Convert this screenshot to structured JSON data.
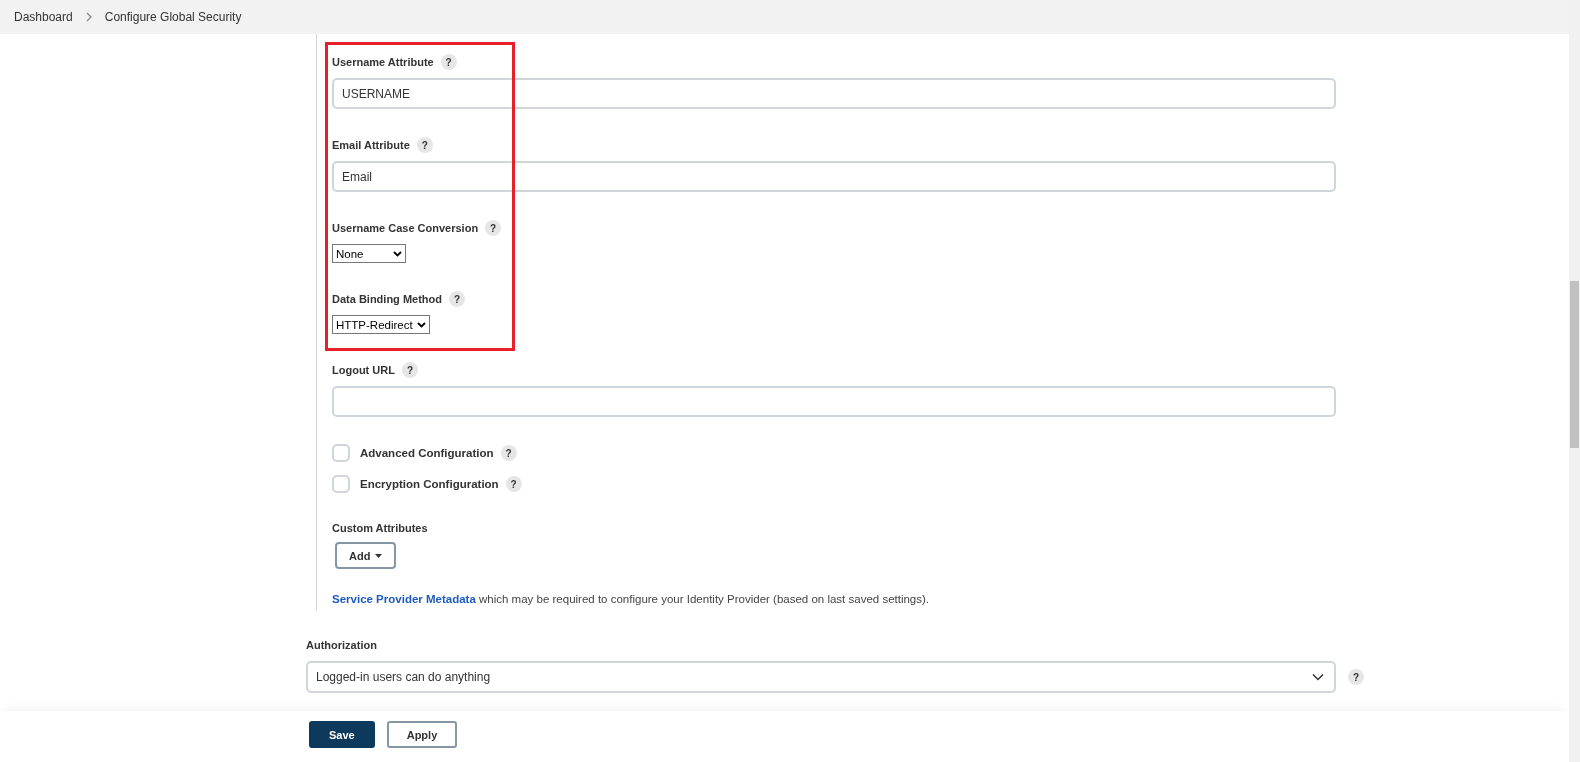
{
  "breadcrumb": [
    {
      "label": "Dashboard"
    },
    {
      "label": "Configure Global Security"
    }
  ],
  "fields": [
    {
      "kind": "text",
      "label": "Username Attribute",
      "help": "?",
      "value": "USERNAME",
      "highlighted": true
    },
    {
      "kind": "text",
      "label": "Email Attribute",
      "help": "?",
      "value": "Email",
      "highlighted": true
    },
    {
      "kind": "select",
      "label": "Username Case Conversion",
      "help": "?",
      "value": "None",
      "highlighted": true
    },
    {
      "kind": "select",
      "label": "Data Binding Method",
      "help": "?",
      "value": "HTTP-Redirect",
      "highlighted": true
    },
    {
      "kind": "text",
      "label": "Logout URL",
      "help": "?",
      "highlighted": false
    }
  ],
  "checkboxes": [
    {
      "label": "Advanced Configuration",
      "help": "?",
      "checked": false
    },
    {
      "label": "Encryption Configuration",
      "help": "?",
      "checked": false
    }
  ],
  "custom_attributes": {
    "label": "Custom Attributes",
    "button": "Add"
  },
  "metadata_note": {
    "link": "Service Provider Metadata",
    "text": "which may be required to configure your Identity Provider (based on last saved settings)."
  },
  "authorization": {
    "label": "Authorization",
    "value": "Logged-in users can do anything",
    "help": "?"
  },
  "buttons": [
    {
      "label": "Save",
      "kind": "primary"
    },
    {
      "label": "Apply",
      "kind": "secondary"
    }
  ]
}
